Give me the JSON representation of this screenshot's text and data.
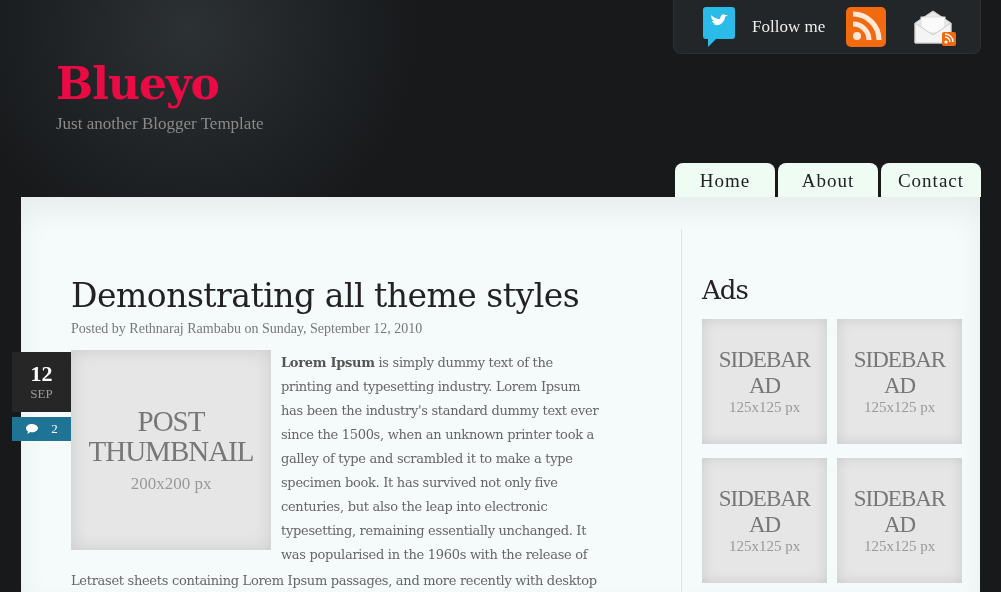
{
  "header": {
    "title": "Blueyo",
    "tagline": "Just another Blogger Template"
  },
  "social": {
    "follow_label": "Follow me"
  },
  "nav_tabs": [
    {
      "label": "Home",
      "selected": false
    },
    {
      "label": "About",
      "selected": false
    },
    {
      "label": "Contact",
      "selected": false
    }
  ],
  "post": {
    "title": "Demonstrating all theme styles",
    "meta": "Posted by Rethnaraj Rambabu on Sunday, September 12, 2010",
    "date": {
      "day": "12",
      "month": "SEP"
    },
    "comments": "2",
    "thumbnail": {
      "label": "POST THUMBNAIL",
      "size": "200x200 px"
    },
    "body": [
      "**Lorem Ipsum** is simply dummy text of the printing and typesetting industry. Lorem Ipsum has been the industry's standard dummy text ever since the 1500s, when an unknown printer took a galley of type and scrambled it to make a type specimen book. It has survived not only five centuries, but also the leap into electronic typesetting, remaining essentially unchanged. It was popularised in the 1960s with the release of",
      "Letraset sheets containing Lorem Ipsum passages, and more recently with desktop"
    ]
  },
  "sidebar": {
    "heading": "Ads",
    "ads": [
      {
        "label": "SIDEBAR AD",
        "size": "125x125 px"
      },
      {
        "label": "SIDEBAR AD",
        "size": "125x125 px"
      },
      {
        "label": "SIDEBAR AD",
        "size": "125x125 px"
      },
      {
        "label": "SIDEBAR AD",
        "size": "125x125 px"
      }
    ]
  }
}
